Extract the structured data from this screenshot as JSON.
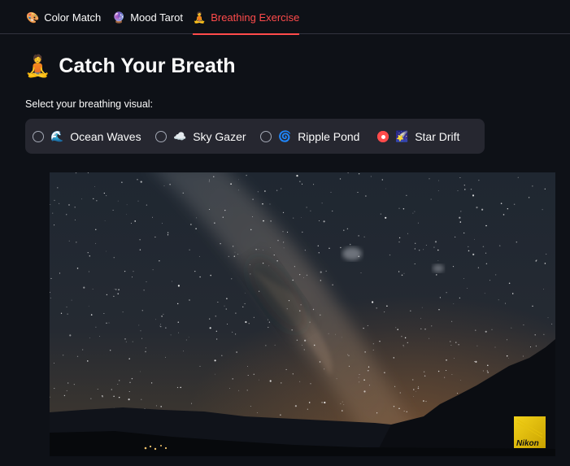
{
  "tabs": [
    {
      "label": "Color Match",
      "icon": "palette-icon",
      "glyph": "🎨",
      "active": false
    },
    {
      "label": "Mood Tarot",
      "icon": "crystal-ball-icon",
      "glyph": "🔮",
      "active": false
    },
    {
      "label": "Breathing Exercise",
      "icon": "person-exhaling-icon",
      "glyph": "🧘",
      "active": true
    }
  ],
  "page": {
    "title": "Catch Your Breath",
    "title_icon": "person-exhaling-icon",
    "title_glyph": "🧘"
  },
  "visual_selector": {
    "label": "Select your breathing visual:",
    "options": [
      {
        "label": "Ocean Waves",
        "icon": "wave-icon",
        "glyph": "🌊",
        "selected": false
      },
      {
        "label": "Sky Gazer",
        "icon": "cloud-icon",
        "glyph": "☁️",
        "selected": false
      },
      {
        "label": "Ripple Pond",
        "icon": "cyclone-icon",
        "glyph": "🌀",
        "selected": false
      },
      {
        "label": "Star Drift",
        "icon": "shooting-star-icon",
        "glyph": "🌠",
        "selected": true
      }
    ],
    "selected_value": "Star Drift"
  },
  "image": {
    "subject": "milky-way-night-sky",
    "watermark_text": "Nikon"
  },
  "colors": {
    "background": "#0e1117",
    "accent": "#ff4b4b",
    "panel": "#262730",
    "text": "#fafafa"
  }
}
